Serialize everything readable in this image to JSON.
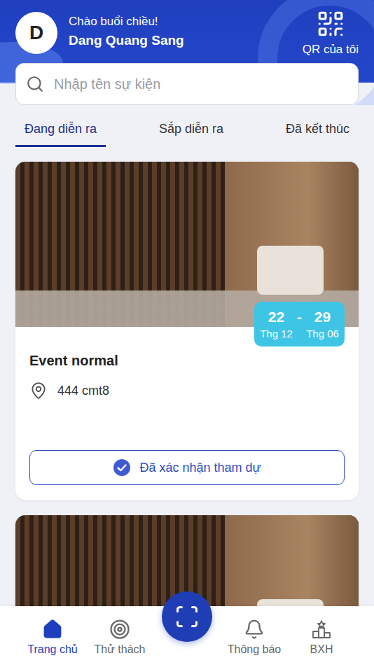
{
  "header": {
    "avatar": "D",
    "greeting": "Chào buổi chiều!",
    "name": "Dang Quang Sang",
    "qr_label": "QR của tôi"
  },
  "search": {
    "placeholder": "Nhập tên sự kiện"
  },
  "tabs": [
    {
      "label": "Đang diễn ra",
      "selected": true
    },
    {
      "label": "Sắp diễn ra",
      "selected": false
    },
    {
      "label": "Đã kết thúc",
      "selected": false
    }
  ],
  "events": [
    {
      "kind": "full",
      "title": "Event normal",
      "location": "444 cmt8",
      "start_day": "22",
      "start_month": "Thg 12",
      "separator": "-",
      "end_day": "29",
      "end_month": "Thg 06",
      "status": "Đã xác nhận tham dự",
      "confirmed": true
    },
    {
      "kind": "image"
    }
  ],
  "nav": [
    {
      "label": "Trang chủ",
      "selected": true
    },
    {
      "label": "Thử thách",
      "selected": false
    },
    {
      "label": "Thông báo",
      "selected": false
    },
    {
      "label": "BXH",
      "selected": false
    }
  ]
}
